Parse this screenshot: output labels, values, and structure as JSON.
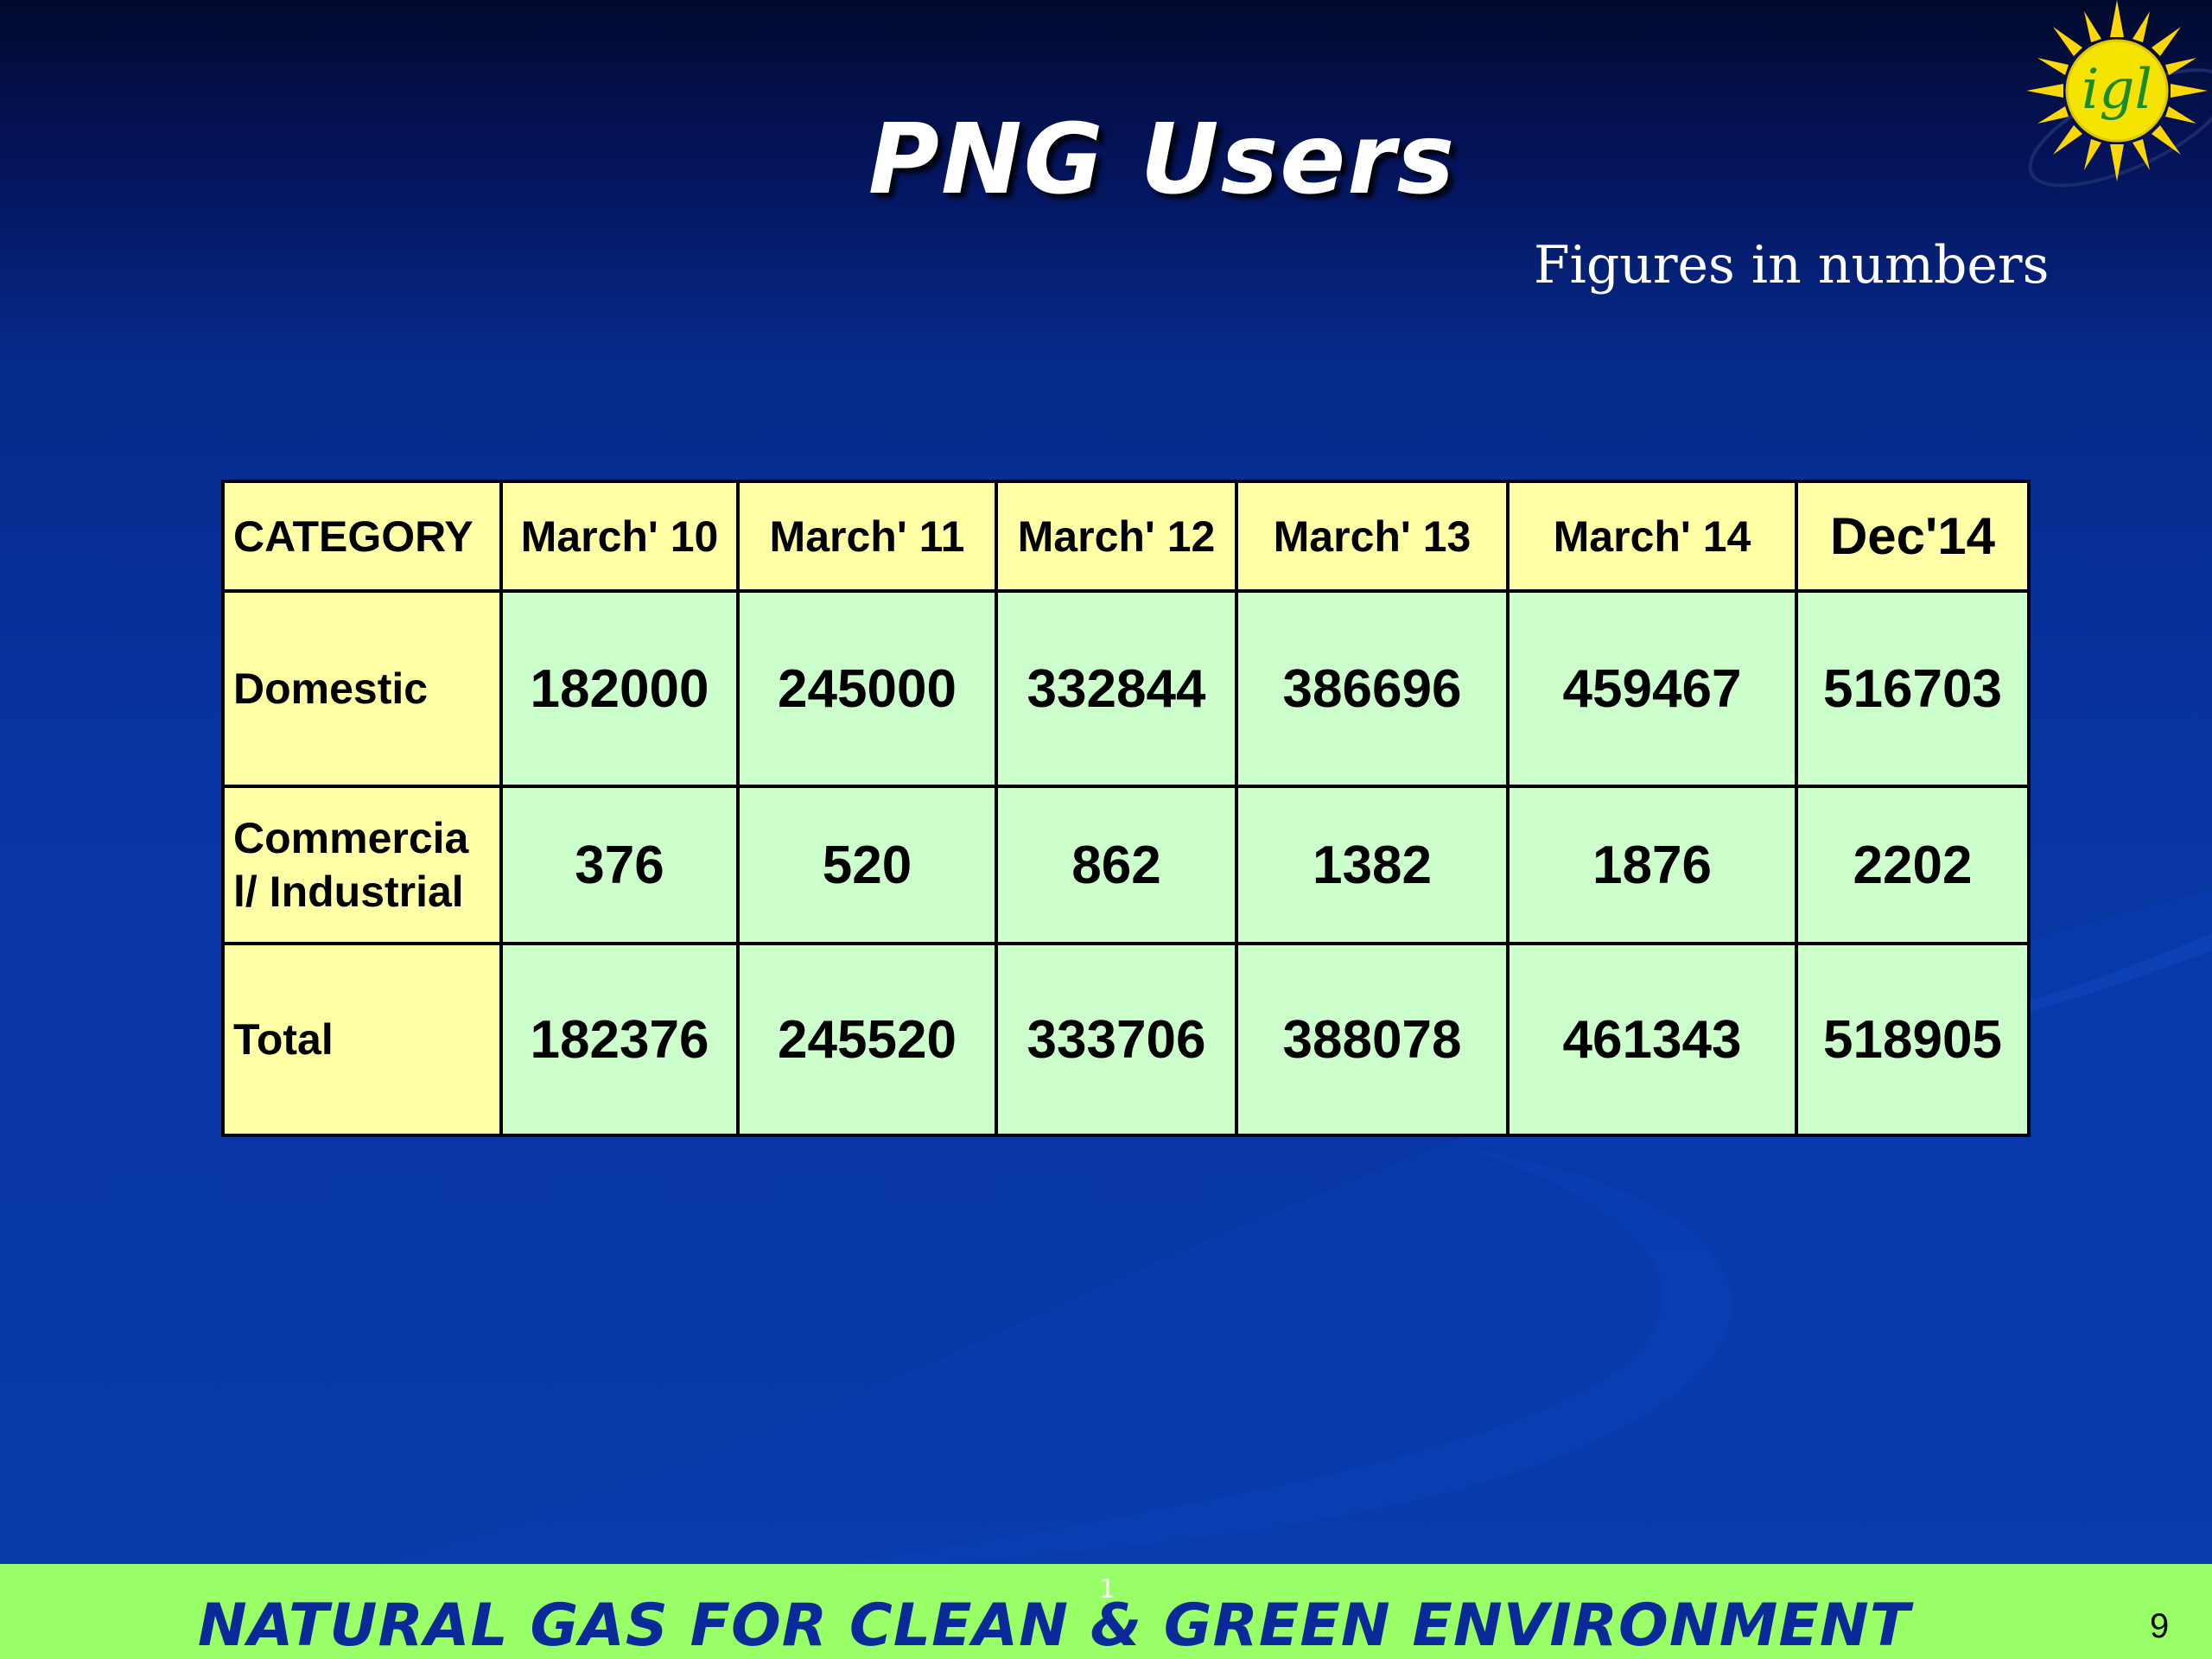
{
  "slide": {
    "title": "PNG Users",
    "subtitle": "Figures in numbers",
    "logo_text": "igl",
    "footer": "NATURAL GAS FOR CLEAN & GREEN ENVIRONMENT",
    "footer_marker": "1",
    "page_number": "9"
  },
  "table": {
    "headers": [
      "CATEGORY",
      "March' 10",
      "March' 11",
      "March' 12",
      "March' 13",
      "March' 14",
      "Dec'14"
    ],
    "rows": [
      {
        "category": "Domestic",
        "values": [
          "182000",
          "245000",
          "332844",
          "386696",
          "459467",
          "516703"
        ]
      },
      {
        "category_line1": "Commercia",
        "category_line2": "l/ Industrial",
        "values": [
          "376",
          "520",
          "862",
          "1382",
          "1876",
          "2202"
        ]
      },
      {
        "category": "Total",
        "values": [
          "182376",
          "245520",
          "333706",
          "388078",
          "461343",
          "518905"
        ]
      }
    ]
  },
  "colors": {
    "header_fill": "#ffffa6",
    "value_fill": "#ccffcc",
    "footer_band": "#99ff66",
    "footer_text": "#0a2a9a",
    "background": "#0838a6"
  }
}
